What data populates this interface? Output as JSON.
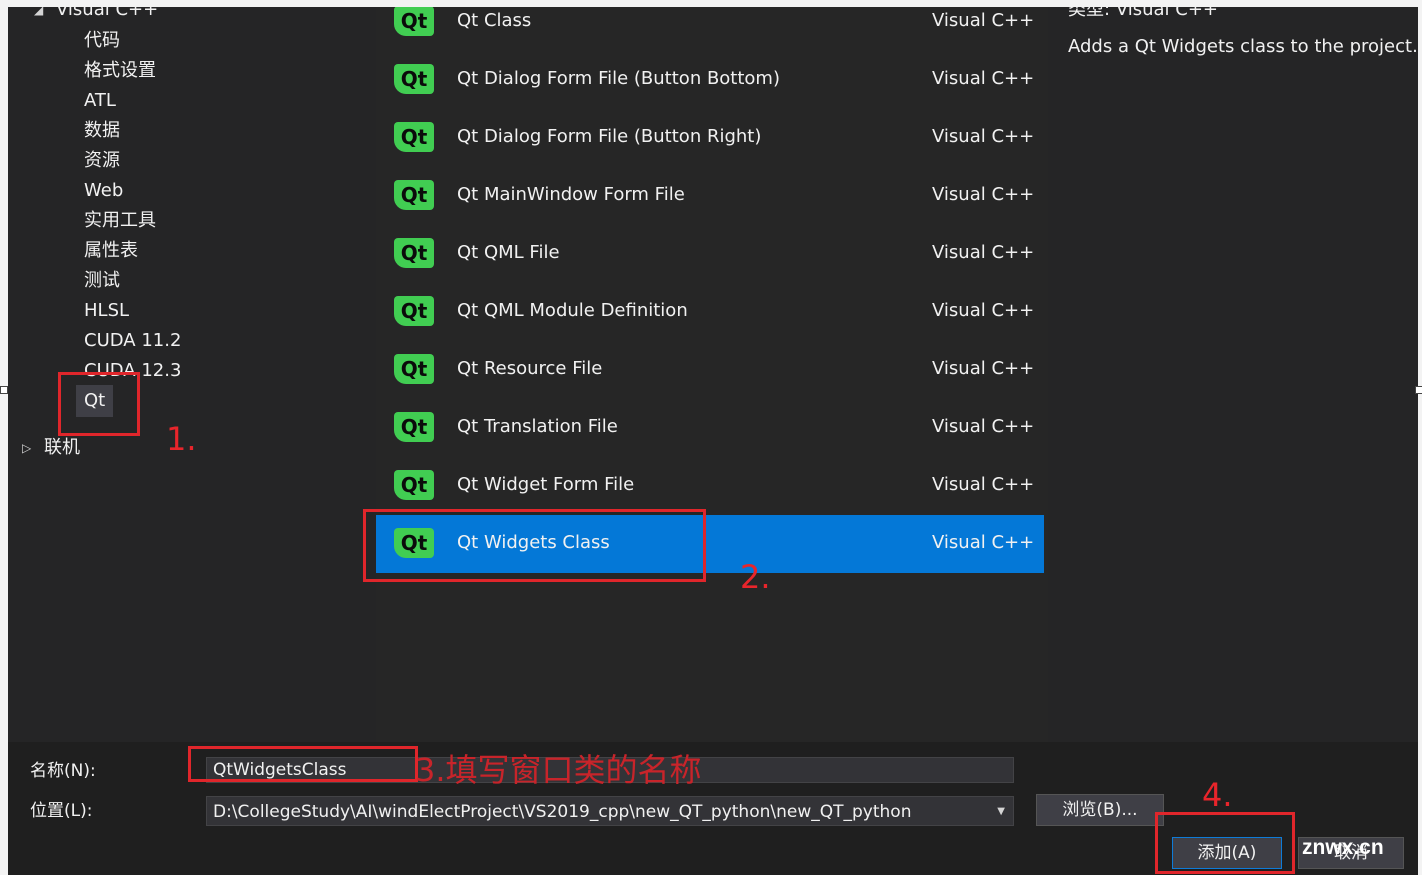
{
  "tree": {
    "root_label": "Visual C++",
    "items": [
      "代码",
      "格式设置",
      "ATL",
      "数据",
      "资源",
      "Web",
      "实用工具",
      "属性表",
      "测试",
      "HLSL",
      "CUDA 11.2",
      "CUDA 12.3",
      "Qt"
    ],
    "online_label": "联机"
  },
  "templates": [
    {
      "name": "Qt Class",
      "lang": "Visual C++",
      "selected": false
    },
    {
      "name": "Qt Dialog Form File (Button Bottom)",
      "lang": "Visual C++",
      "selected": false
    },
    {
      "name": "Qt Dialog Form File (Button Right)",
      "lang": "Visual C++",
      "selected": false
    },
    {
      "name": "Qt MainWindow Form File",
      "lang": "Visual C++",
      "selected": false
    },
    {
      "name": "Qt QML File",
      "lang": "Visual C++",
      "selected": false
    },
    {
      "name": "Qt QML Module Definition",
      "lang": "Visual C++",
      "selected": false
    },
    {
      "name": "Qt Resource File",
      "lang": "Visual C++",
      "selected": false
    },
    {
      "name": "Qt Translation File",
      "lang": "Visual C++",
      "selected": false
    },
    {
      "name": "Qt Widget Form File",
      "lang": "Visual C++",
      "selected": false
    },
    {
      "name": "Qt Widgets Class",
      "lang": "Visual C++",
      "selected": true
    }
  ],
  "qt_logo_text": "Qt",
  "info": {
    "type_label": "类型:",
    "type_value": "Visual C++",
    "description": "Adds a Qt Widgets class to the project."
  },
  "form": {
    "name_label": "名称(N):",
    "name_value": "QtWidgetsClass",
    "location_label": "位置(L):",
    "location_value": "D:\\CollegeStudy\\AI\\windElectProject\\VS2019_cpp\\new_QT_python\\new_QT_python",
    "browse_label": "浏览(B)...",
    "add_label": "添加(A)",
    "cancel_label": "取消"
  },
  "annotations": {
    "step1": "1.",
    "step2": "2.",
    "step3": "3.填写窗口类的名称",
    "step4": "4."
  },
  "watermark": "znwx.cn",
  "colors": {
    "qt_green": "#41cd52",
    "selection_blue": "#0478d7",
    "annotation_red": "#e0262b",
    "dialog_bg": "#1f1f1f"
  }
}
